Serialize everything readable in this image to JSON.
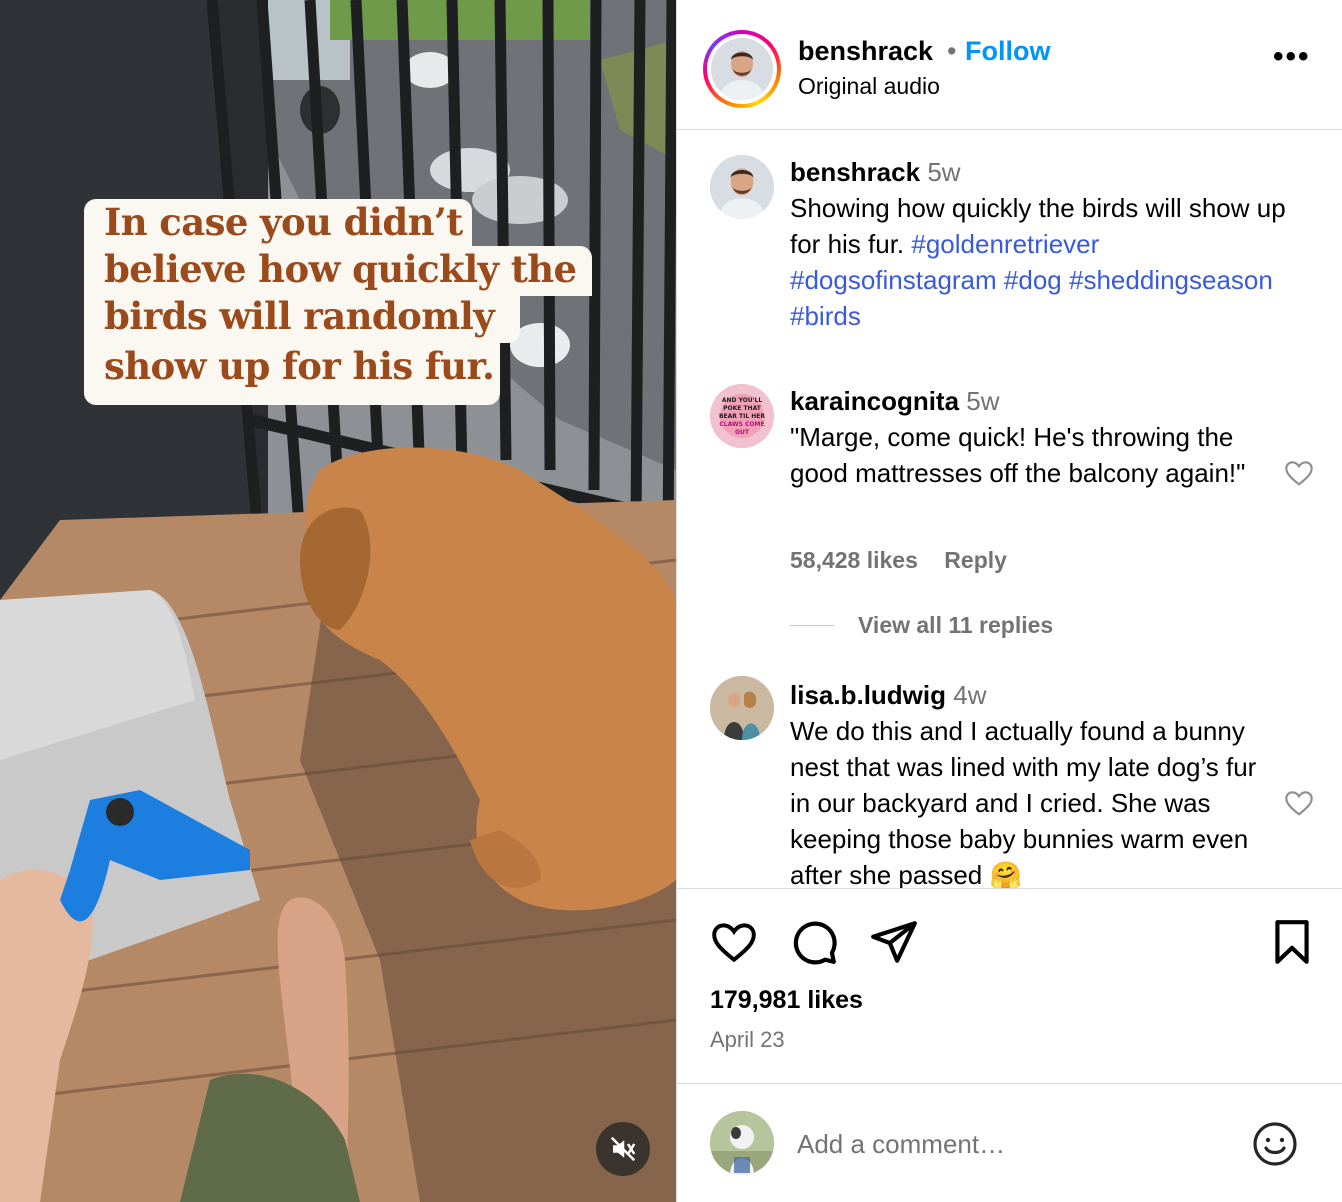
{
  "video": {
    "caption_lines": [
      "In case you didn’t",
      "believe how quickly the",
      "birds will randomly",
      "show up for his fur."
    ],
    "mute_icon": "speaker-muted-icon"
  },
  "post_header": {
    "username": "benshrack",
    "separator": "•",
    "follow_label": "Follow",
    "audio_label": "Original audio",
    "more_label": "•••"
  },
  "caption": {
    "username": "benshrack",
    "time": "5w",
    "text": "Showing how quickly the birds will show up for his fur.",
    "hashtags": [
      "#goldenretriever",
      "#dogsofinstagram",
      "#dog",
      "#sheddingseason",
      "#birds"
    ]
  },
  "comments": [
    {
      "username": "karaincognita",
      "time": "5w",
      "text": "\"Marge, come quick! He's throwing the good mattresses off the balcony again!\"",
      "likes": "58,428 likes",
      "reply_label": "Reply",
      "view_replies": "View all 11 replies",
      "avatar_text": [
        "AND YOU'LL",
        "POKE THAT",
        "BEAR TIL HER",
        "CLAWS COME",
        "OUT"
      ]
    },
    {
      "username": "lisa.b.ludwig",
      "time": "4w",
      "text": "We do this and I actually found a bunny nest that was lined with my late dog’s fur in our backyard and I cried. She was keeping those baby bunnies warm even after she passed",
      "emoji": "🤗"
    }
  ],
  "actions": {
    "likes": "179,981 likes",
    "date": "April 23",
    "icons": [
      "heart-icon",
      "comment-icon",
      "share-icon",
      "bookmark-icon"
    ]
  },
  "add_comment": {
    "placeholder": "Add a comment…"
  },
  "colors": {
    "follow_blue": "#0095f6",
    "hashtag_blue": "#3a5bd9",
    "muted_gray": "#737373",
    "caption_text": "#9a4a1b",
    "divider": "#dbdbdb"
  }
}
